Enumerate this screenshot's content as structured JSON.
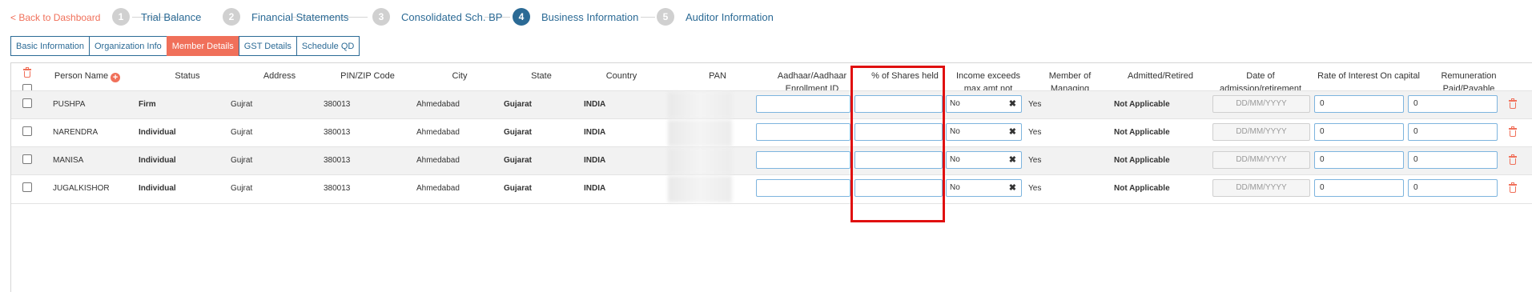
{
  "nav": {
    "back_label": "< Back to Dashboard",
    "steps": [
      {
        "num": "1",
        "label": "Trial Balance"
      },
      {
        "num": "2",
        "label": "Financial Statements"
      },
      {
        "num": "3",
        "label": "Consolidated Sch. BP"
      },
      {
        "num": "4",
        "label": "Business Information"
      },
      {
        "num": "5",
        "label": "Auditor Information"
      }
    ],
    "active_step": 4
  },
  "tabs": [
    "Basic Information",
    "Organization Info",
    "Member Details",
    "GST Details",
    "Schedule QD"
  ],
  "active_tab": "Member Details",
  "table": {
    "headers": {
      "person_name": "Person Name",
      "status": "Status",
      "address": "Address",
      "pin": "PIN/ZIP Code",
      "city": "City",
      "state": "State",
      "country": "Country",
      "pan": "PAN",
      "aadhaar": "Aadhaar/Aadhaar Enrollment ID",
      "shares": "% of Shares held",
      "income": "Income exceeds max amt not charged to Tax",
      "member_committee": "Member of Managing Commiitee?",
      "admitted": "Admitted/Retired",
      "date": "Date of admission/retirement",
      "rate": "Rate of Interest On capital",
      "remuneration": "Remuneration Paid/Payable"
    },
    "rows": [
      {
        "name": "PUSHPA",
        "status": "Firm",
        "address": "Gujrat",
        "pin": "380013",
        "city": "Ahmedabad",
        "state": "Gujarat",
        "country": "INDIA",
        "aadhaar": "",
        "shares": "",
        "income": "No",
        "member_committee": "Yes",
        "admitted": "Not Applicable",
        "date_placeholder": "DD/MM/YYYY",
        "rate": "0",
        "remuneration": "0"
      },
      {
        "name": "NARENDRA",
        "status": "Individual",
        "address": "Gujrat",
        "pin": "380013",
        "city": "Ahmedabad",
        "state": "Gujarat",
        "country": "INDIA",
        "aadhaar": "",
        "shares": "",
        "income": "No",
        "member_committee": "Yes",
        "admitted": "Not Applicable",
        "date_placeholder": "DD/MM/YYYY",
        "rate": "0",
        "remuneration": "0"
      },
      {
        "name": "MANISA",
        "status": "Individual",
        "address": "Gujrat",
        "pin": "380013",
        "city": "Ahmedabad",
        "state": "Gujarat",
        "country": "INDIA",
        "aadhaar": "",
        "shares": "",
        "income": "No",
        "member_committee": "Yes",
        "admitted": "Not Applicable",
        "date_placeholder": "DD/MM/YYYY",
        "rate": "0",
        "remuneration": "0"
      },
      {
        "name": "JUGALKISHOR",
        "status": "Individual",
        "address": "Gujrat",
        "pin": "380013",
        "city": "Ahmedabad",
        "state": "Gujarat",
        "country": "INDIA",
        "aadhaar": "",
        "shares": "",
        "income": "No",
        "member_committee": "Yes",
        "admitted": "Not Applicable",
        "date_placeholder": "DD/MM/YYYY",
        "rate": "0",
        "remuneration": "0"
      }
    ]
  },
  "colors": {
    "accent": "#f0705a",
    "primary": "#2b6a95",
    "highlight": "#e01010"
  }
}
